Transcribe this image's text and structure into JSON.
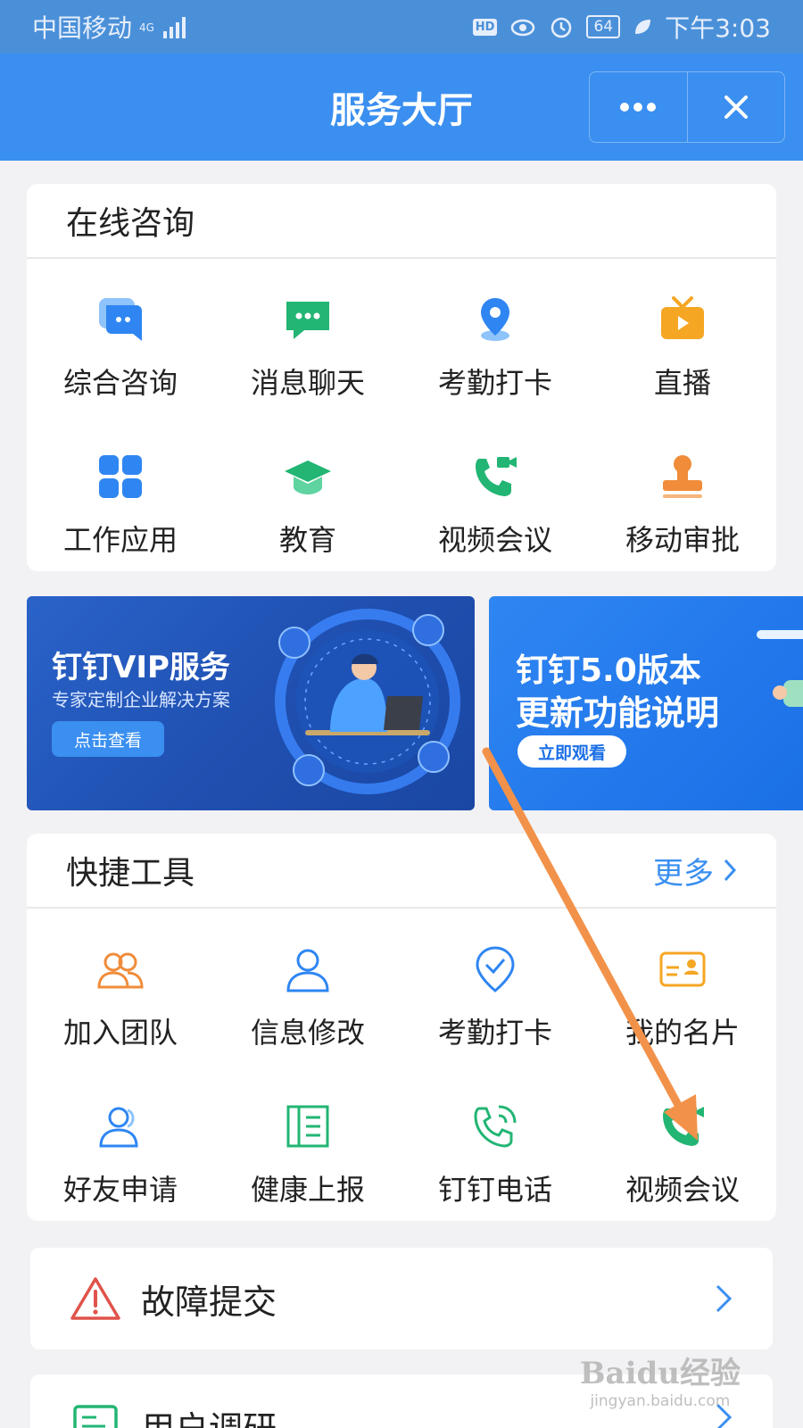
{
  "status_bar": {
    "carrier": "中国移动",
    "network": "4G",
    "hd": "HD",
    "battery": "64",
    "time": "下午3:03"
  },
  "title_bar": {
    "title": "服务大厅"
  },
  "online": {
    "heading": "在线咨询",
    "items": [
      {
        "label": "综合咨询",
        "icon": "chat-bubble-icon",
        "color": "#2f86f2"
      },
      {
        "label": "消息聊天",
        "icon": "message-icon",
        "color": "#22b573"
      },
      {
        "label": "考勤打卡",
        "icon": "location-pin-icon",
        "color": "#2f86f2"
      },
      {
        "label": "直播",
        "icon": "tv-play-icon",
        "color": "#f5a623"
      },
      {
        "label": "工作应用",
        "icon": "apps-grid-icon",
        "color": "#2f86f2"
      },
      {
        "label": "教育",
        "icon": "graduation-cap-icon",
        "color": "#22b573"
      },
      {
        "label": "视频会议",
        "icon": "video-call-icon",
        "color": "#22b573"
      },
      {
        "label": "移动审批",
        "icon": "stamp-icon",
        "color": "#f08c3a"
      }
    ]
  },
  "banners": [
    {
      "title": "钉钉VIP服务",
      "subtitle": "专家定制企业解决方案",
      "button": "点击查看"
    },
    {
      "title_line1": "钉钉5.0版本",
      "title_line2": "更新功能说明",
      "button": "立即观看"
    }
  ],
  "tools": {
    "heading": "快捷工具",
    "more": "更多",
    "items": [
      {
        "label": "加入团队",
        "icon": "team-icon",
        "color": "#f08c3a"
      },
      {
        "label": "信息修改",
        "icon": "user-icon",
        "color": "#2f86f2"
      },
      {
        "label": "考勤打卡",
        "icon": "check-pin-icon",
        "color": "#2f86f2"
      },
      {
        "label": "我的名片",
        "icon": "business-card-icon",
        "color": "#f5a623"
      },
      {
        "label": "好友申请",
        "icon": "friend-icon",
        "color": "#2f86f2"
      },
      {
        "label": "健康上报",
        "icon": "book-icon",
        "color": "#22b573"
      },
      {
        "label": "钉钉电话",
        "icon": "phone-ring-icon",
        "color": "#22b573"
      },
      {
        "label": "视频会议",
        "icon": "video-call-icon",
        "color": "#22b573"
      }
    ]
  },
  "fault": {
    "label": "故障提交"
  },
  "survey": {
    "label": "用户调研"
  },
  "watermark": {
    "line1": "Baidu经验",
    "line2": "jingyan.baidu.com"
  }
}
